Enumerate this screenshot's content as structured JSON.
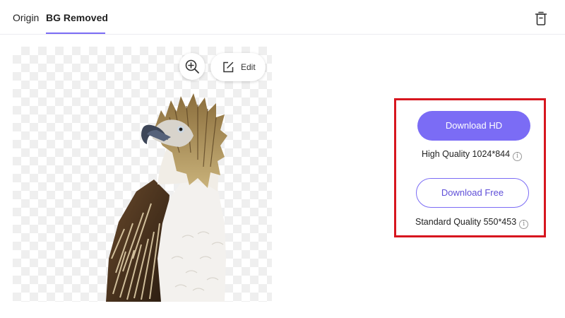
{
  "tabs": {
    "origin": "Origin",
    "bg_removed": "BG Removed",
    "accent_color": "#7b6cf5"
  },
  "toolbar": {
    "delete_icon": "trash-icon",
    "zoom_icon": "zoom-in-icon",
    "edit_icon": "edit-icon",
    "edit_label": "Edit"
  },
  "image": {
    "subject": "eagle-cutout",
    "background": "transparent-checkerboard"
  },
  "download": {
    "highlight_color": "#d7161f",
    "hd_button": "Download HD",
    "hd_quality": "High Quality 1024*844",
    "free_button": "Download Free",
    "free_quality": "Standard Quality 550*453",
    "info_icon": "info-icon",
    "info_glyph": "i"
  }
}
